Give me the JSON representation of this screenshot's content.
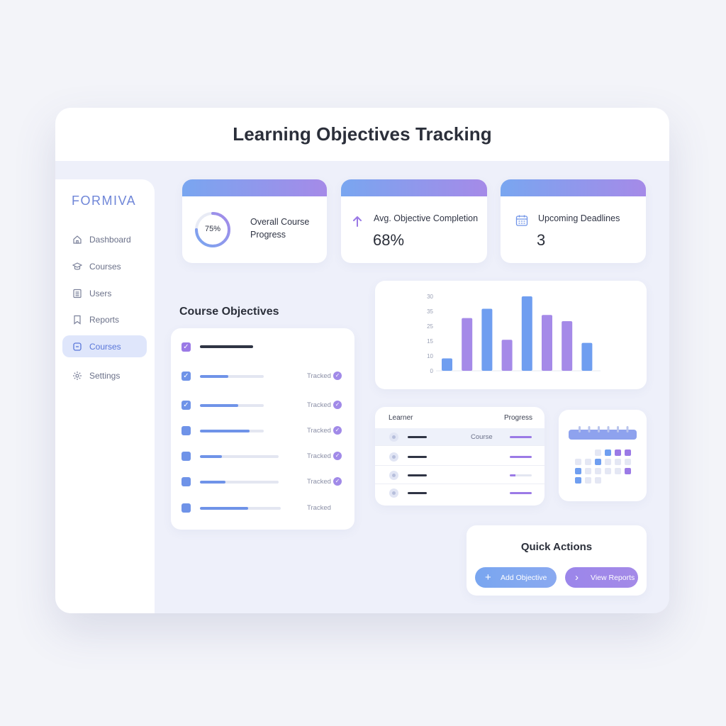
{
  "window": {
    "title": "Learning Objectives Tracking"
  },
  "sidebar": {
    "brand": "FORMIVA",
    "items": [
      {
        "label": "Dashboard",
        "icon": "home-icon"
      },
      {
        "label": "Courses",
        "icon": "graduation-cap-icon"
      },
      {
        "label": "Users",
        "icon": "list-icon"
      },
      {
        "label": "Reports",
        "icon": "bookmark-icon"
      },
      {
        "label": "Courses",
        "icon": "chat-square-icon",
        "active": true
      },
      {
        "label": "Settings",
        "icon": "gear-icon"
      }
    ]
  },
  "stats": {
    "progress": {
      "label_line1": "Overall Course",
      "label_line2": "Progress",
      "value": "75%",
      "fraction": 0.75
    },
    "completion": {
      "label": "Avg. Objective Completion",
      "value": "68%",
      "icon": "arrow-up-icon"
    },
    "deadlines": {
      "label": "Upcoming Deadlines",
      "value": "3",
      "icon": "calendar-icon"
    }
  },
  "objectives": {
    "title": "Course Objectives",
    "status_label": "Tracked",
    "rows": [
      {
        "checked": true,
        "progress": 0.44
      },
      {
        "checked": true,
        "progress": 0.6
      },
      {
        "checked": false,
        "progress": 0.78
      },
      {
        "checked": false,
        "progress": 0.28
      },
      {
        "checked": false,
        "progress": 0.32
      },
      {
        "checked": false,
        "progress": 0.6
      }
    ]
  },
  "chart_data": {
    "type": "bar",
    "yticks": [
      "0",
      "10",
      "15",
      "25",
      "35",
      "30"
    ],
    "values": [
      4,
      17,
      20,
      10,
      24,
      18,
      16,
      9
    ],
    "ylim": [
      0,
      24
    ],
    "colors": [
      "#6f9ef0",
      "#a58ae8",
      "#6f9ef0",
      "#a58ae8",
      "#6f9ef0",
      "#a58ae8",
      "#a58ae8",
      "#6f9ef0"
    ]
  },
  "learners": {
    "col_learner": "Learner",
    "col_progress": "Progress",
    "course_label": "Course",
    "rows": [
      {
        "progress": 1.0,
        "show_course": true
      },
      {
        "progress": 1.0,
        "show_course": false
      },
      {
        "progress": 0.25,
        "show_course": false
      },
      {
        "progress": 1.0,
        "show_course": false
      }
    ]
  },
  "quick_actions": {
    "title": "Quick Actions",
    "add_label": "Add Objective",
    "view_label": "View Reports"
  },
  "colors": {
    "accent_blue": "#6f93e8",
    "accent_purple": "#9b7ae6"
  }
}
